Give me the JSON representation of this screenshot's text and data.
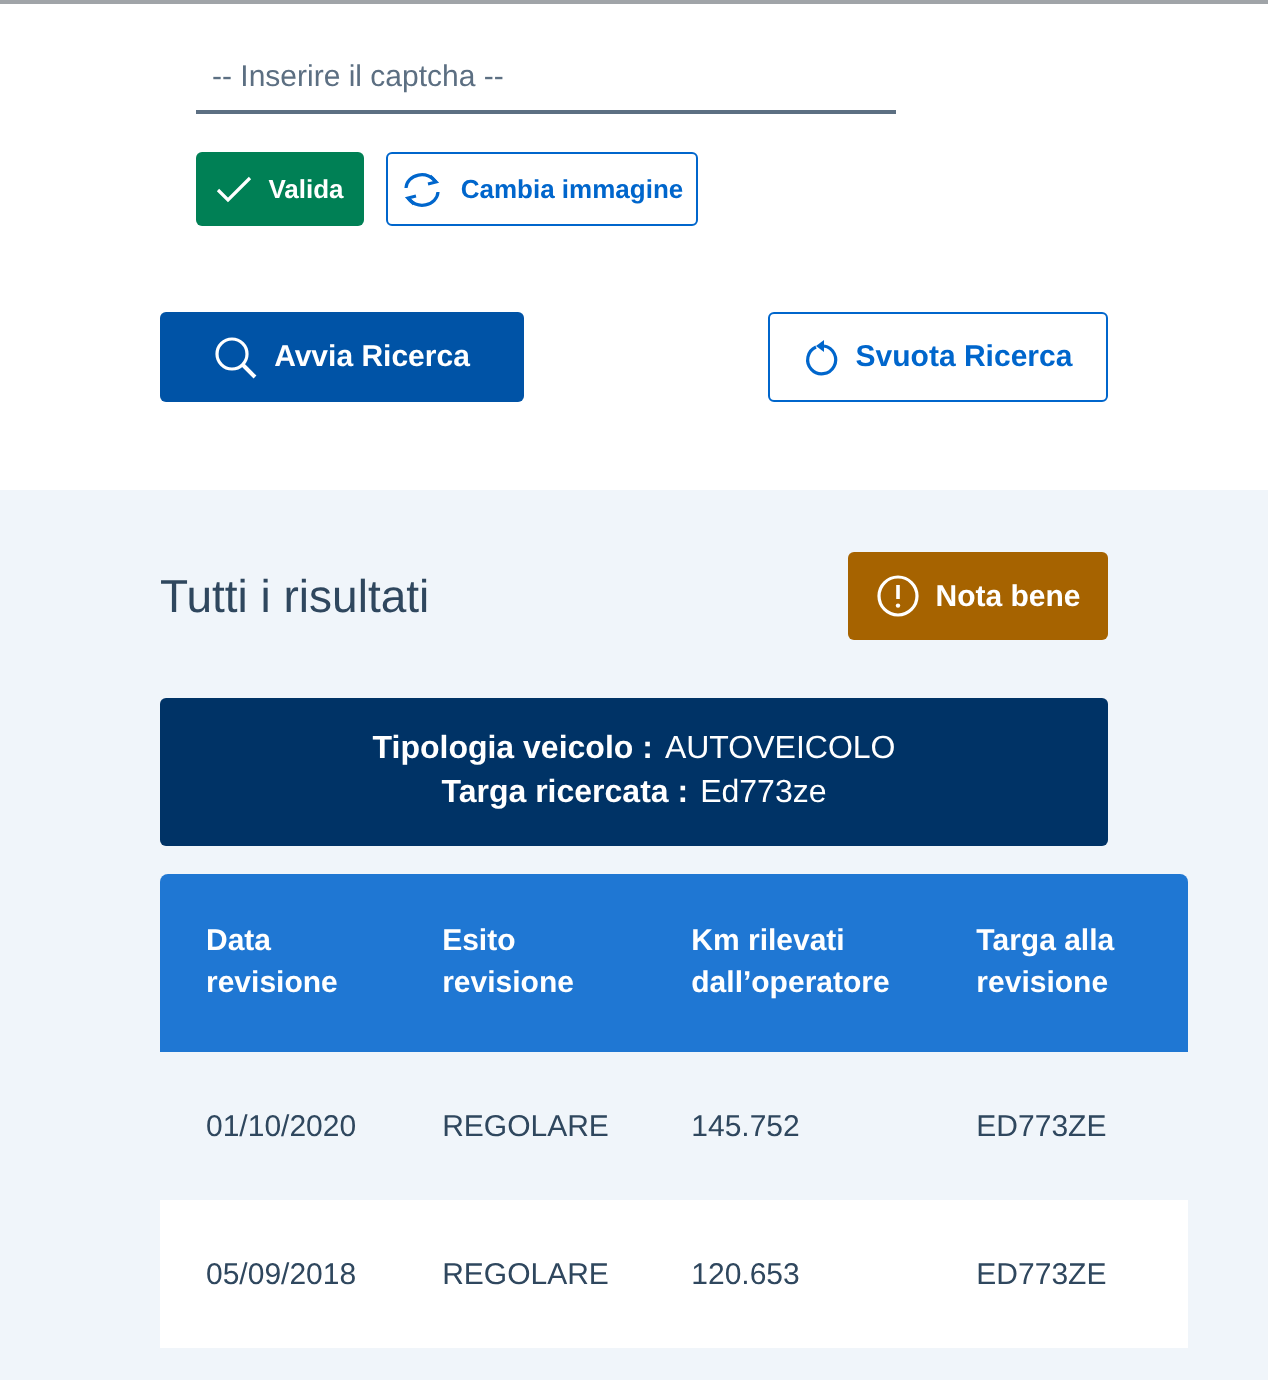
{
  "captcha": {
    "placeholder": "-- Inserire il captcha --"
  },
  "captcha_buttons": [
    {
      "kind": "validate",
      "label": "Valida"
    },
    {
      "kind": "refresh",
      "label": "Cambia immagine"
    }
  ],
  "search_buttons": [
    {
      "kind": "search",
      "label": "Avvia Ricerca"
    },
    {
      "kind": "reset",
      "label": "Svuota Ricerca"
    }
  ],
  "results": {
    "title": "Tutti i risultati",
    "note_button": "Nota bene",
    "info": [
      {
        "label": "Tipologia veicolo :",
        "value": "AUTOVEICOLO"
      },
      {
        "label": "Targa ricercata :",
        "value": "Ed773ze"
      }
    ],
    "table": {
      "columns": [
        "Data revisione",
        "Esito revisione",
        "Km rilevati dall’operatore",
        "Targa alla revisione"
      ],
      "rows": [
        [
          "01/10/2020",
          "REGOLARE",
          "145.752",
          "ED773ZE"
        ],
        [
          "05/09/2018",
          "REGOLARE",
          "120.653",
          "ED773ZE"
        ]
      ]
    }
  }
}
